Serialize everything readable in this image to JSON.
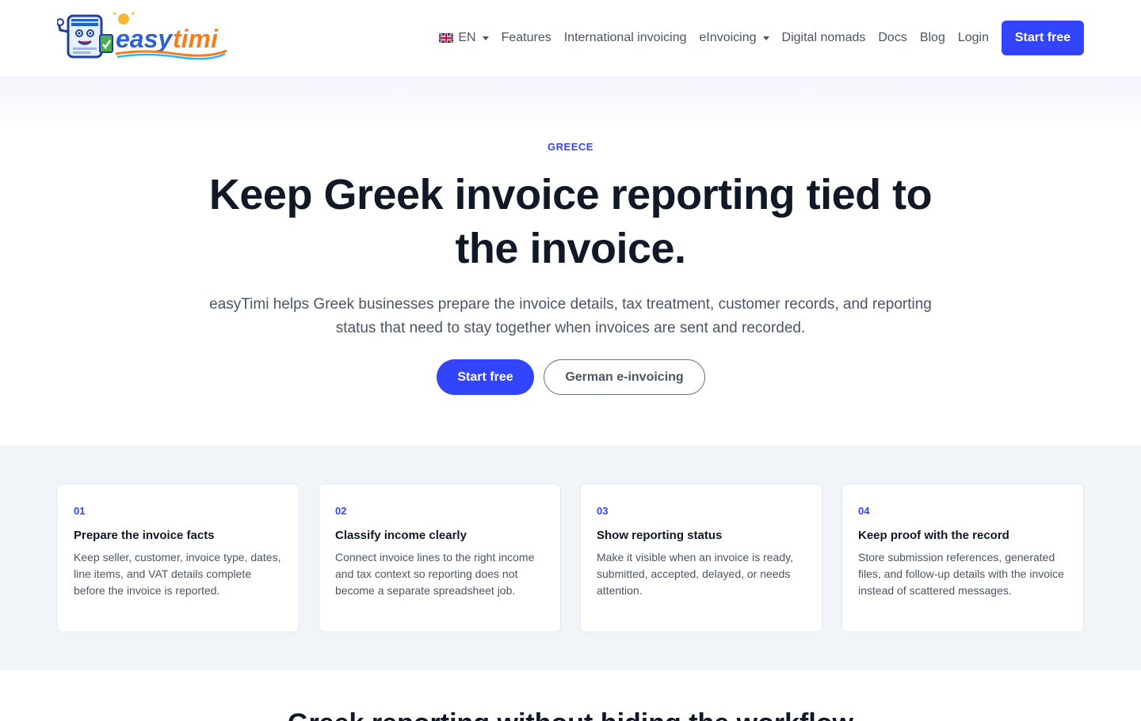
{
  "brand": {
    "logo_text": "easytimi",
    "colors": {
      "primary": "#3344ff",
      "heading": "#111827",
      "muted": "#4b5563",
      "band": "#f1f4f9"
    }
  },
  "nav": {
    "language": {
      "flag_icon": "uk-flag-icon",
      "label": "EN"
    },
    "items": [
      {
        "label": "Features",
        "dropdown": false
      },
      {
        "label": "International invoicing",
        "dropdown": false
      },
      {
        "label": "eInvoicing",
        "dropdown": true
      },
      {
        "label": "Digital nomads",
        "dropdown": false
      },
      {
        "label": "Docs",
        "dropdown": false
      },
      {
        "label": "Blog",
        "dropdown": false
      },
      {
        "label": "Login",
        "dropdown": false
      }
    ],
    "cta_label": "Start free"
  },
  "hero": {
    "eyebrow": "GREECE",
    "title": "Keep Greek invoice reporting tied to the invoice.",
    "subtitle": "easyTimi helps Greek businesses prepare the invoice details, tax treatment, customer records, and reporting status that need to stay together when invoices are sent and recorded.",
    "primary_cta": "Start free",
    "secondary_cta": "German e-invoicing"
  },
  "features": [
    {
      "number": "01",
      "title": "Prepare the invoice facts",
      "text": "Keep seller, customer, invoice type, dates, line items, and VAT details complete before the invoice is reported."
    },
    {
      "number": "02",
      "title": "Classify income clearly",
      "text": "Connect invoice lines to the right income and tax context so reporting does not become a separate spreadsheet job."
    },
    {
      "number": "03",
      "title": "Show reporting status",
      "text": "Make it visible when an invoice is ready, submitted, accepted, delayed, or needs attention."
    },
    {
      "number": "04",
      "title": "Keep proof with the record",
      "text": "Store submission references, generated files, and follow-up details with the invoice instead of scattered messages."
    }
  ],
  "section2": {
    "title": "Greek reporting without hiding the workflow"
  }
}
